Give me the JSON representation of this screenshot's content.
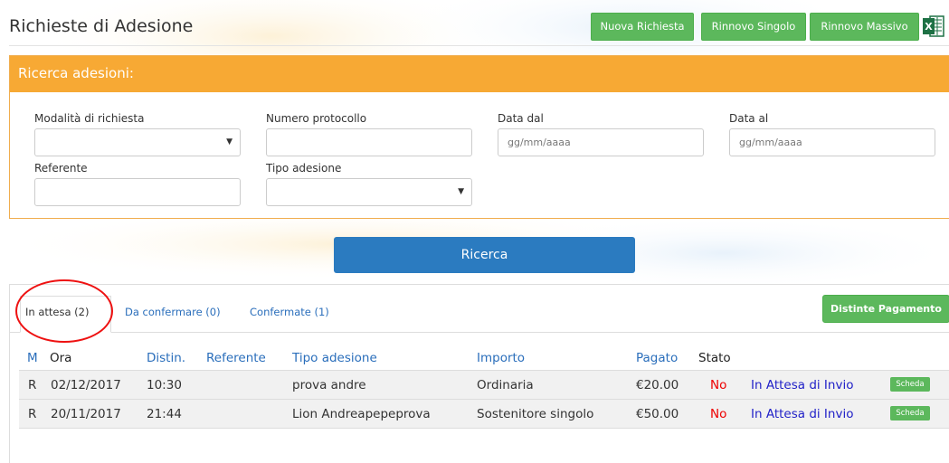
{
  "header": {
    "title": "Richieste di Adesione",
    "buttons": [
      "Nuova Richiesta",
      "Rinnovo Singolo",
      "Rinnovo Massivo"
    ],
    "export_icon": "excel-icon"
  },
  "search": {
    "title": "Ricerca adesioni:",
    "modalita_label": "Modalità di richiesta",
    "protocollo_label": "Numero protocollo",
    "data_dal_label": "Data dal",
    "data_dal_placeholder": "gg/mm/aaaa",
    "data_al_label": "Data al",
    "data_al_placeholder": "gg/mm/aaaa",
    "referente_label": "Referente",
    "tipo_label": "Tipo adesione",
    "button": "Ricerca"
  },
  "results": {
    "tabs": [
      "In attesa (2)",
      "Da confermare (0)",
      "Confermate (1)"
    ],
    "distinte_button": "Distinte Pagamento",
    "columns": [
      "M",
      "Ora",
      "Distin.",
      "Referente",
      "Tipo adesione",
      "Importo",
      "Pagato",
      "Stato"
    ],
    "rows": [
      {
        "m": "R",
        "date": "02/12/2017",
        "time": "10:30",
        "referente": "prova andre",
        "tipo": "Ordinaria",
        "importo": "€20.00",
        "pagato": "No",
        "stato": "In Attesa di Invio",
        "action": "Scheda"
      },
      {
        "m": "R",
        "date": "20/11/2017",
        "time": "21:44",
        "referente": "Lion Andreapepeprova",
        "tipo": "Sostenitore singolo",
        "importo": "€50.00",
        "pagato": "No",
        "stato": "In Attesa di Invio",
        "action": "Scheda"
      }
    ]
  },
  "colors": {
    "green": "#5cb85c",
    "orange": "#f7a934",
    "blue": "#2b7bc0",
    "highlight": "#e11111"
  }
}
